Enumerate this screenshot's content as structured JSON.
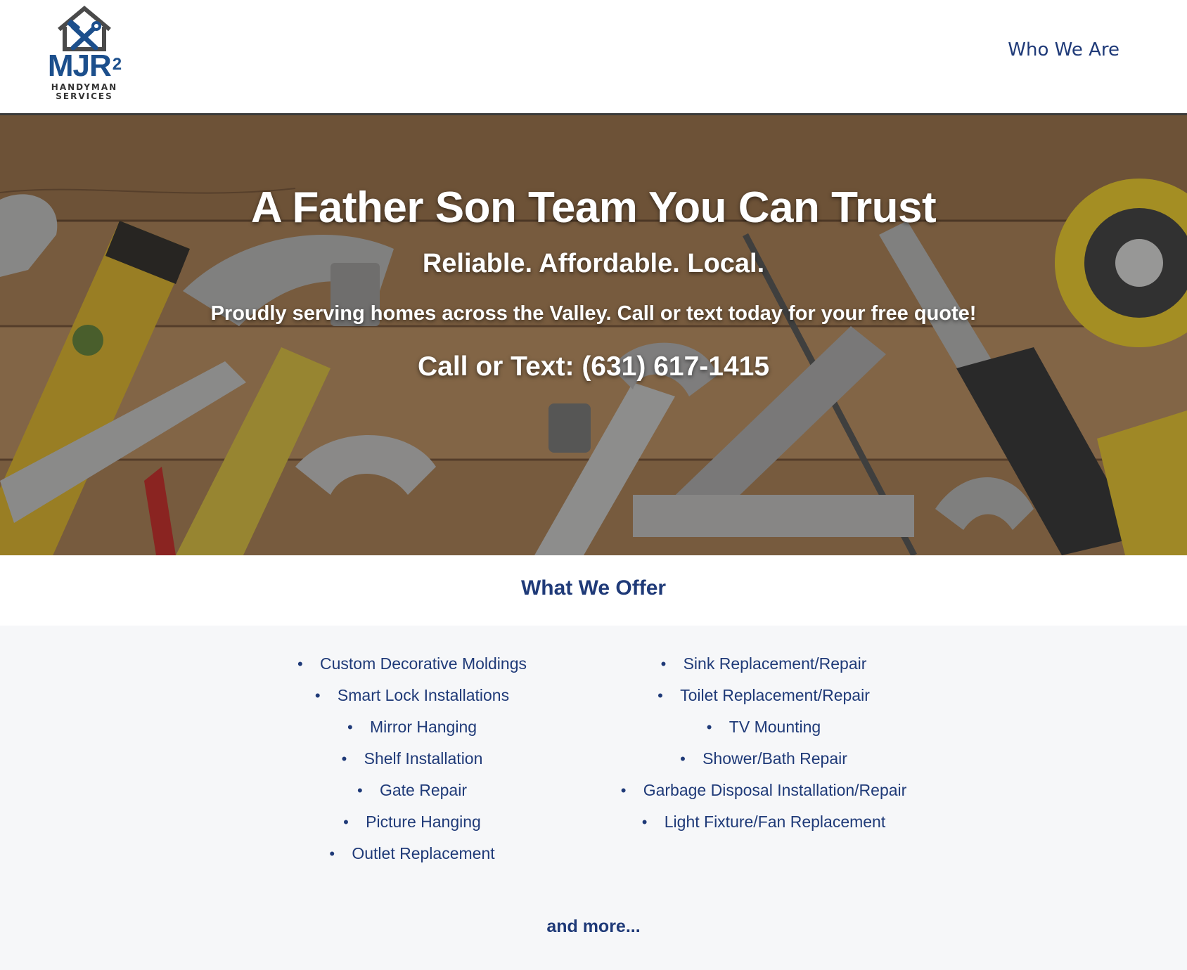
{
  "logo": {
    "word": "MJR",
    "sup": "2",
    "sub1": "HANDYMAN",
    "sub2": "SERVICES"
  },
  "nav": {
    "who_we_are": "Who We Are"
  },
  "hero": {
    "title": "A Father Son Team You Can Trust",
    "tagline": "Reliable. Affordable. Local.",
    "description": "Proudly serving homes across the Valley. Call or text today for your free quote!",
    "phone_label": "Call or Text: ",
    "phone_number": "(631) 617-1415"
  },
  "offer": {
    "title": "What We Offer",
    "left_items": [
      "Custom Decorative Moldings",
      "Smart Lock Installations",
      "Mirror Hanging",
      "Shelf Installation",
      "Gate Repair",
      "Picture Hanging",
      "Outlet Replacement"
    ],
    "right_items": [
      "Sink Replacement/Repair",
      "Toilet Replacement/Repair",
      "TV Mounting",
      "Shower/Bath Repair",
      "Garbage Disposal Installation/Repair",
      "Light Fixture/Fan Replacement"
    ],
    "more": "and more..."
  },
  "colors": {
    "brand_blue": "#1f3a78",
    "logo_blue": "#1c4f8c",
    "services_bg": "#f6f7f9"
  }
}
